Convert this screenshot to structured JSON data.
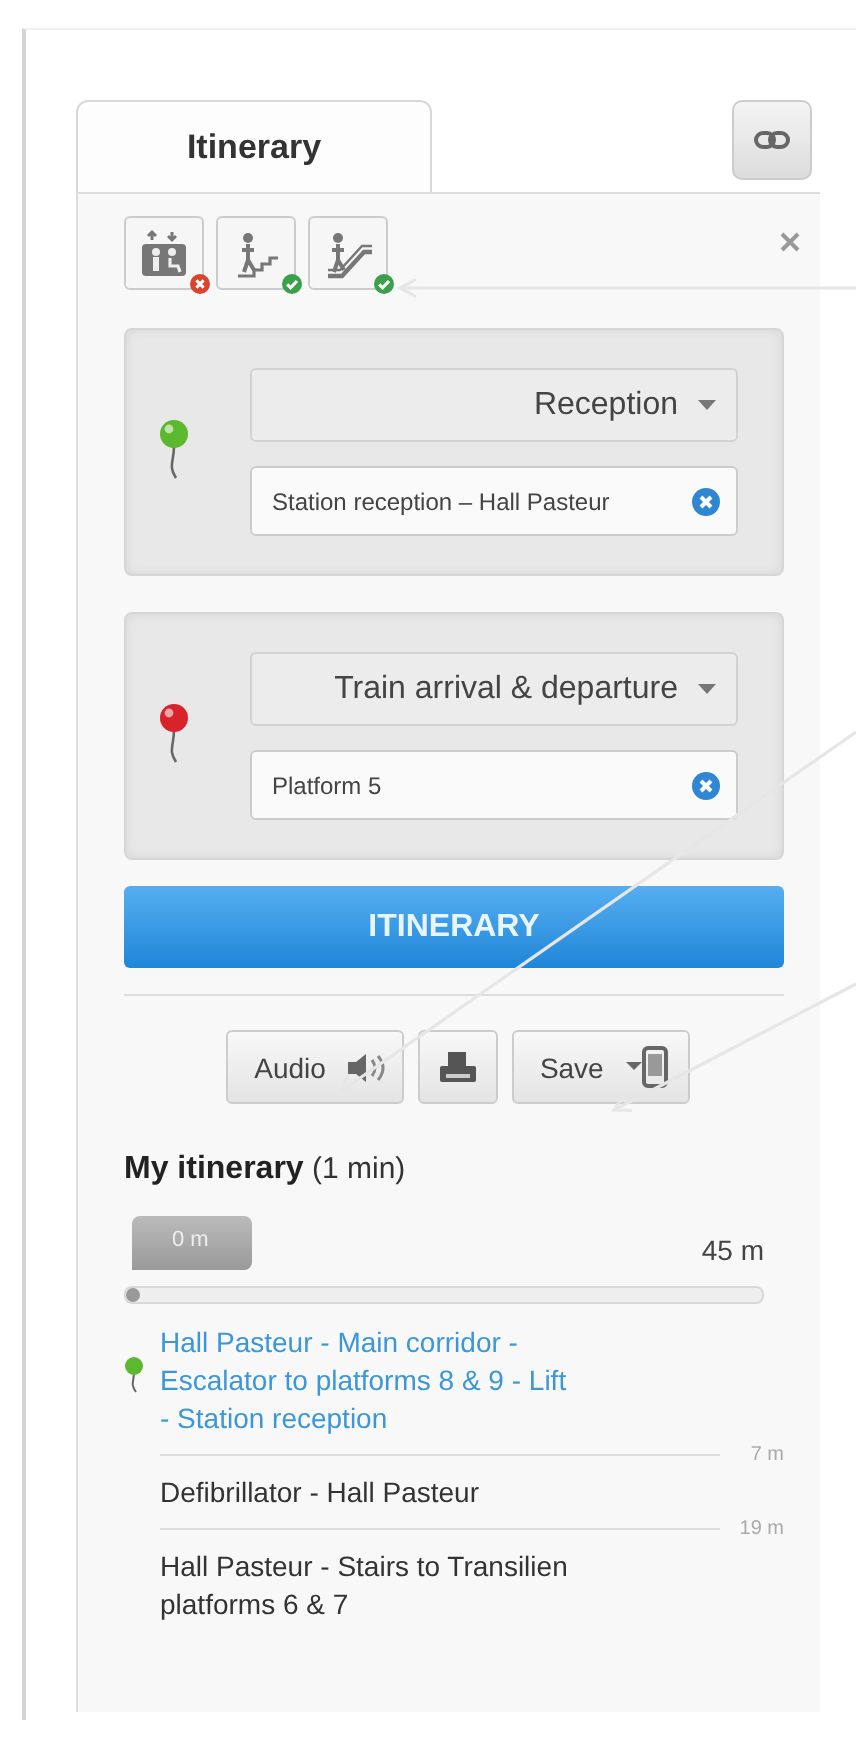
{
  "tabs": [
    {
      "label": "Itinerary",
      "selected": true
    }
  ],
  "filters": [
    {
      "kind": "lift",
      "included": false
    },
    {
      "kind": "stairs",
      "included": true
    },
    {
      "kind": "escalator",
      "included": true
    }
  ],
  "stops": [
    {
      "category": "Reception",
      "value": "Station reception – Hall Pasteur",
      "color": "#5cb82e"
    },
    {
      "category": "Train arrival & departure",
      "value": "Platform 5",
      "color": "#d9232b"
    }
  ],
  "submit_button": "ITINERARY",
  "actions": [
    {
      "kind": "audio",
      "label": "Audio"
    },
    {
      "kind": "print"
    },
    {
      "kind": "save",
      "label": "Save"
    }
  ],
  "summary": {
    "title": "My itinerary",
    "duration": "(1 min)"
  },
  "progress": {
    "start": "0 m",
    "end": "45 m",
    "level": 0
  },
  "steps": [
    {
      "text": "Hall Pasteur - Main corridor - Escalator to platforms 8 & 9 - Lift - Station reception",
      "selected": true,
      "distance": "7 m"
    },
    {
      "text": "Defibrillator - Hall Pasteur",
      "selected": false,
      "distance": "19 m"
    },
    {
      "text": "Hall Pasteur - Stairs to Transilien platforms 6 & 7",
      "selected": false
    }
  ]
}
